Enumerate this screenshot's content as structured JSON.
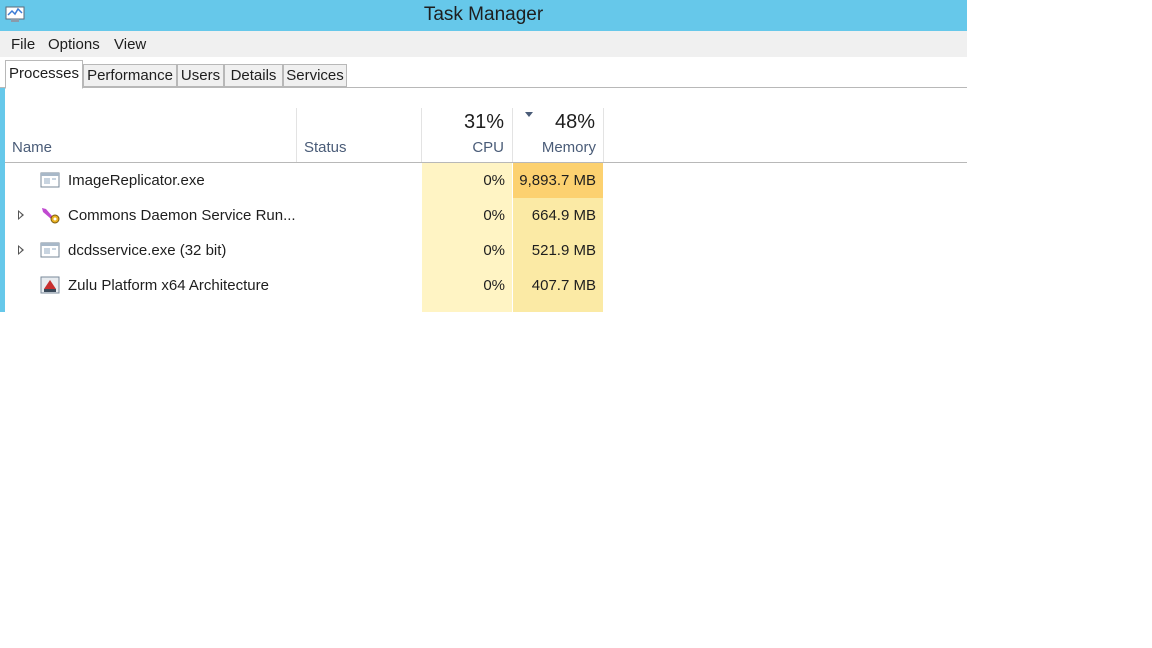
{
  "window": {
    "title": "Task Manager"
  },
  "menu": [
    "File",
    "Options",
    "View"
  ],
  "tabs": [
    "Processes",
    "Performance",
    "Users",
    "Details",
    "Services"
  ],
  "columns": {
    "name": "Name",
    "status": "Status",
    "cpu": {
      "label": "CPU",
      "total": "31%"
    },
    "memory": {
      "label": "Memory",
      "total": "48%"
    }
  },
  "processes": [
    {
      "name": "ImageReplicator.exe",
      "cpu": "0%",
      "memory": "9,893.7 MB",
      "expandable": false,
      "icon": "app-window-icon"
    },
    {
      "name": "Commons Daemon Service Run...",
      "cpu": "0%",
      "memory": "664.9 MB",
      "expandable": true,
      "icon": "feather-gear-icon"
    },
    {
      "name": "dcdsservice.exe (32 bit)",
      "cpu": "0%",
      "memory": "521.9 MB",
      "expandable": true,
      "icon": "app-window-icon"
    },
    {
      "name": "Zulu Platform x64 Architecture",
      "cpu": "0%",
      "memory": "407.7 MB",
      "expandable": false,
      "icon": "java-cup-icon"
    }
  ],
  "colors": {
    "titlebar": "#66c8ea",
    "cpu_column": "#fff4c4",
    "memory_column": "#fbeaa5",
    "memory_hot": "#fcd170"
  }
}
